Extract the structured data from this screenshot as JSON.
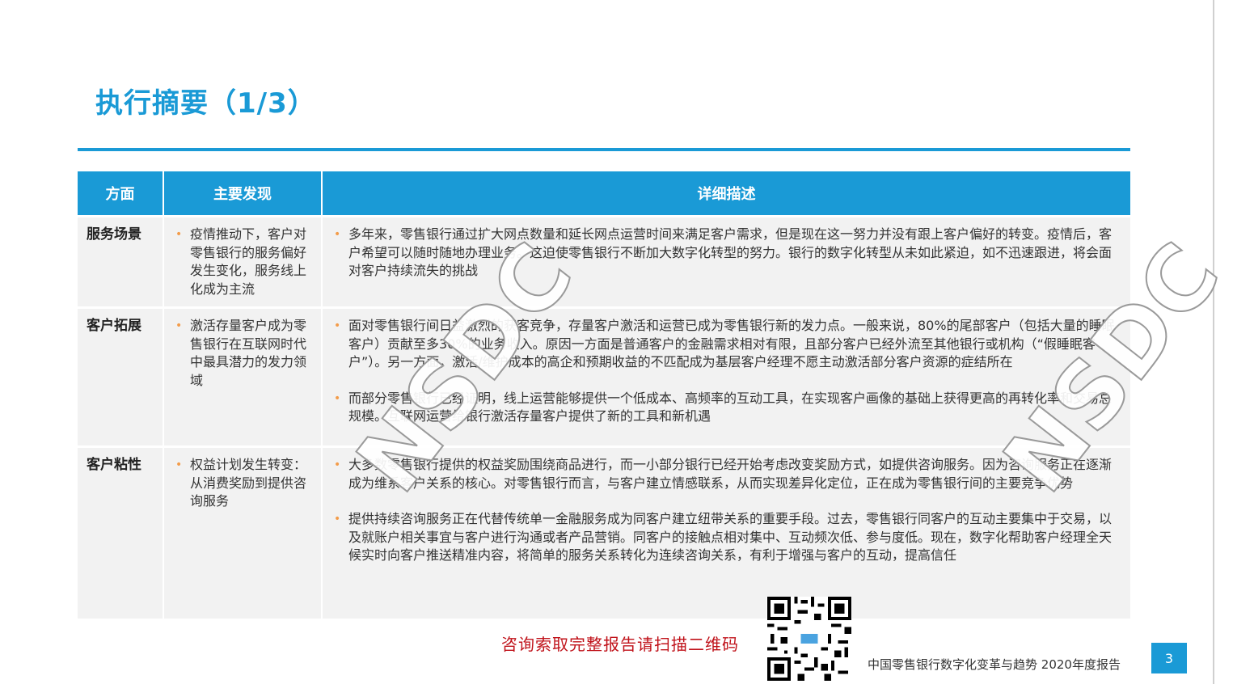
{
  "title": "执行摘要（1/3）",
  "table": {
    "headers": [
      "方面",
      "主要发现",
      "详细描述"
    ],
    "rows": [
      {
        "aspect": "服务场景",
        "finding": "疫情推动下，客户对零售银行的服务偏好发生变化，服务线上化成为主流",
        "details": [
          "多年来，零售银行通过扩大网点数量和延长网点运营时间来满足客户需求，但是现在这一努力并没有跟上客户偏好的转变。疫情后，客户希望可以随时随地办理业务。这迫使零售银行不断加大数字化转型的努力。银行的数字化转型从未如此紧迫，如不迅速跟进，将会面对客户持续流失的挑战"
        ]
      },
      {
        "aspect": "客户拓展",
        "finding": "激活存量客户成为零售银行在互联网时代中最具潜力的发力领域",
        "details": [
          "面对零售银行间日益激烈的获客竞争，存量客户激活和运营已成为零售银行新的发力点。一般来说，80%的尾部客户（包括大量的睡眠客户）贡献至多30%的业务收入。原因一方面是普通客户的金融需求相对有限，且部分客户已经外流至其他银行或机构（“假睡眠客户”）。另一方面，激活/维护成本的高企和预期收益的不匹配成为基层客户经理不愿主动激活部分客户资源的症结所在",
          "而部分零售银行已经证明，线上运营能够提供一个低成本、高频率的互动工具，在实现客户画像的基础上获得更高的再转化率和交易总规模。互联网运营给银行激活存量客户提供了新的工具和新机遇"
        ]
      },
      {
        "aspect": "客户粘性",
        "finding": "权益计划发生转变：从消费奖励到提供咨询服务",
        "details": [
          "大多数零售银行提供的权益奖励围绕商品进行，而一小部分银行已经开始考虑改变奖励方式，如提供咨询服务。因为咨询服务正在逐渐成为维系客户关系的核心。对零售银行而言，与客户建立情感联系，从而实现差异化定位，正在成为零售银行间的主要竞争优势",
          "提供持续咨询服务正在代替传统单一金融服务成为同客户建立纽带关系的重要手段。过去，零售银行同客户的互动主要集中于交易，以及就账户相关事宜与客户进行沟通或者产品营销。同客户的接触点相对集中、互动频次低、参与度低。现在，数字化帮助客户经理全天候实时向客户推送精准内容，将简单的服务关系转化为连续咨询关系，有利于增强与客户的互动，提高信任"
        ]
      }
    ]
  },
  "watermark": "NSDC",
  "qr_caption": "咨询索取完整报告请扫描二维码",
  "footer": "中国零售银行数字化变革与趋势 2020年度报告",
  "page_number": "3",
  "colors": {
    "accent": "#1a9ad6",
    "bullet": "#f39c4a",
    "caption": "#c0121a",
    "cell_bg": "#f2f2f2"
  }
}
